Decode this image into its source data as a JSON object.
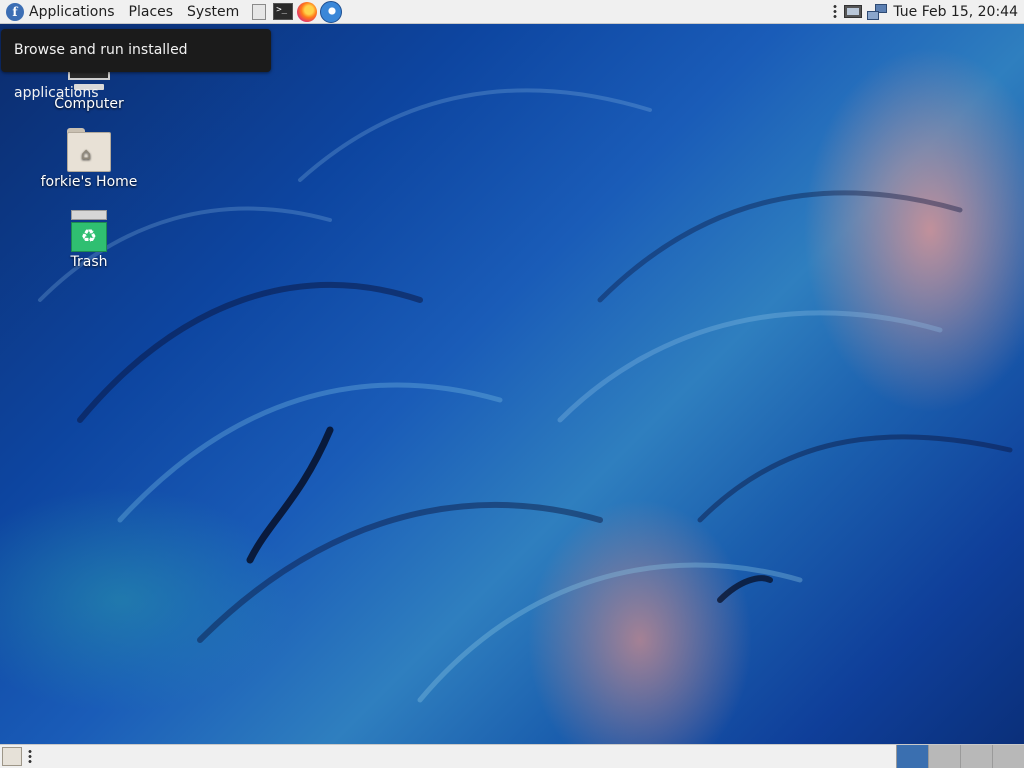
{
  "top_panel": {
    "menus": [
      {
        "label": "Applications",
        "icon": "fedora-logo-icon"
      },
      {
        "label": "Places"
      },
      {
        "label": "System"
      }
    ],
    "launchers": [
      "file-manager-icon",
      "terminal-icon",
      "firefox-icon",
      "thunderbird-icon"
    ],
    "terminal_glyph": ">_",
    "tray": [
      "display-icon",
      "network-icon"
    ],
    "clock": "Tue Feb 15, 20:44"
  },
  "tooltip": {
    "text": "Browse and run installed applications"
  },
  "desktop_icons": [
    {
      "label": "Computer",
      "icon": "computer-icon"
    },
    {
      "label": "forkie's Home",
      "icon": "home-folder-icon"
    },
    {
      "label": "Trash",
      "icon": "trash-icon"
    }
  ],
  "bottom_panel": {
    "workspaces": {
      "count": 4,
      "active_index": 0
    }
  },
  "colors": {
    "panel_bg": "#f0f0f0",
    "active_workspace": "#3a6fb0",
    "tooltip_bg": "#1b1b1b"
  }
}
